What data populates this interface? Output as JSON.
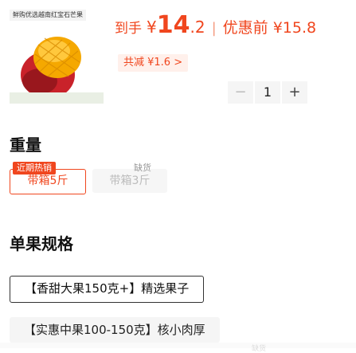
{
  "product": {
    "thumb_tag": "鲜购优选越南红宝石芒果",
    "price_label": "到手",
    "currency": "¥",
    "price_int": "14",
    "price_dec": ".2",
    "separator": "|",
    "coupon_text": "优惠前 ¥15.8",
    "saving_text": "共减 ¥1.6 >"
  },
  "stepper": {
    "minus": "−",
    "quantity": "1",
    "plus": "+"
  },
  "spec_section": {
    "title": "重量",
    "hot_tag": "近期热销",
    "stock_note": "缺货",
    "options": [
      {
        "label": "带箱5斤",
        "selected": true
      },
      {
        "label": "带箱3斤",
        "selected": false
      }
    ]
  },
  "fruit_section": {
    "title": "单果规格",
    "options": [
      {
        "label": "【香甜大果150克+】精选果子",
        "selected": true
      },
      {
        "label": "【实惠中果100-150克】核小肉厚",
        "selected": false
      }
    ]
  },
  "footer": {
    "mark": "缺货"
  },
  "colors": {
    "accent": "#f0461e",
    "mango_yellow": "#f7b500",
    "mango_red": "#c9222a"
  }
}
